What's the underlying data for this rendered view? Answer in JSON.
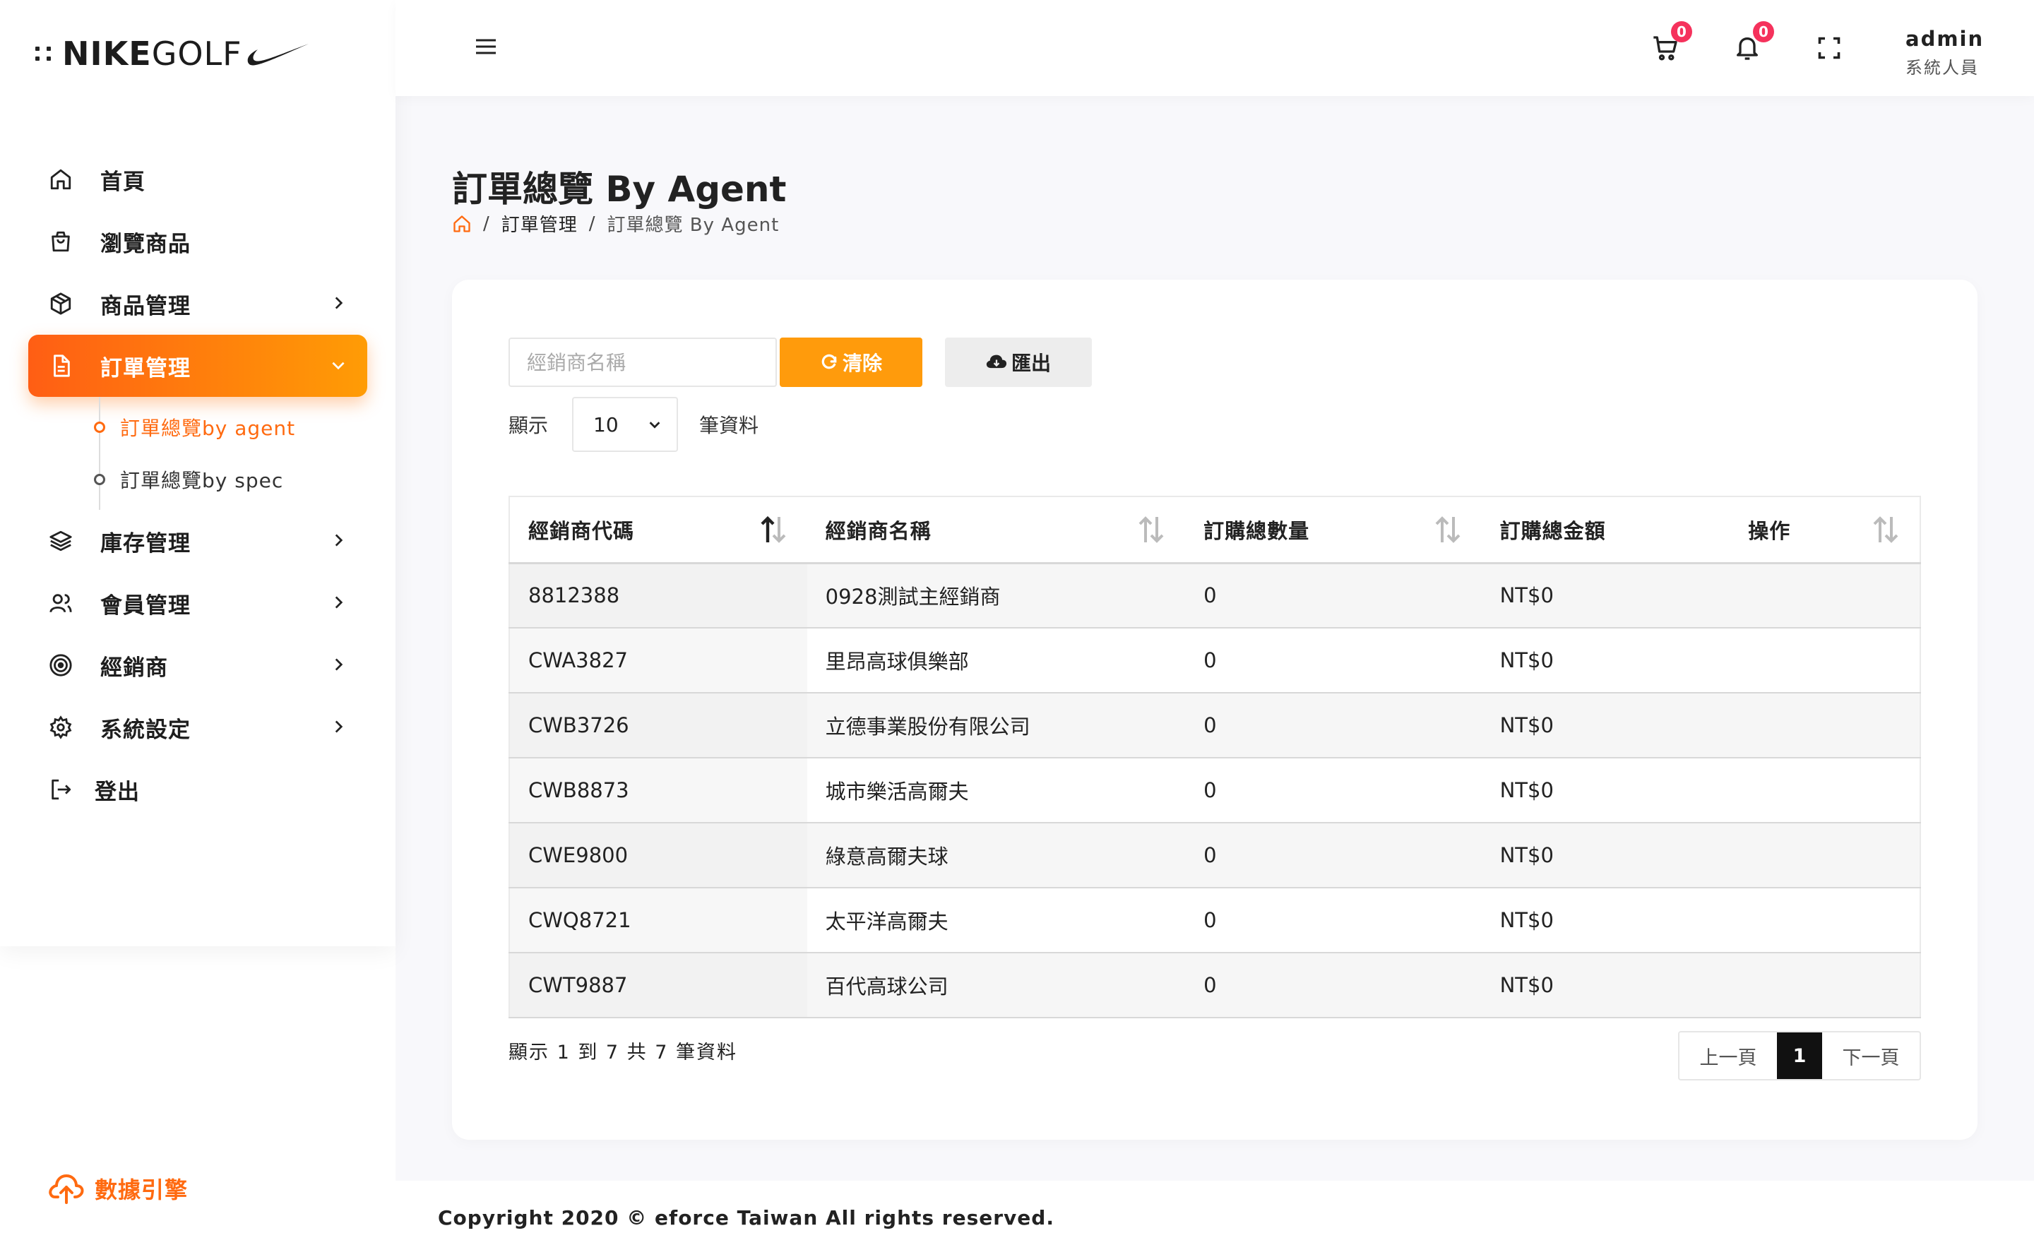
{
  "brand": {
    "logo_text_bold": "NIKE",
    "logo_text_light": "GOLF"
  },
  "sidebar": {
    "items": [
      {
        "label": "首頁",
        "icon": "home-icon"
      },
      {
        "label": "瀏覽商品",
        "icon": "shopping-bag-icon"
      },
      {
        "label": "商品管理",
        "icon": "box-icon"
      },
      {
        "label": "訂單管理",
        "icon": "file-text-icon"
      },
      {
        "label": "庫存管理",
        "icon": "layers-icon"
      },
      {
        "label": "會員管理",
        "icon": "users-icon"
      },
      {
        "label": "經銷商",
        "icon": "target-icon"
      },
      {
        "label": "系統設定",
        "icon": "gear-icon"
      },
      {
        "label": "登出",
        "icon": "logout-icon"
      }
    ],
    "subitems": [
      {
        "label": "訂單總覽by agent"
      },
      {
        "label": "訂單總覽by spec"
      }
    ],
    "data_engine": "數據引擎"
  },
  "header": {
    "cart_count": "0",
    "notification_count": "0",
    "user_name": "admin",
    "user_role": "系統人員"
  },
  "page": {
    "title": "訂單總覽 By Agent",
    "breadcrumb": {
      "section": "訂單管理",
      "current": "訂單總覽 By Agent"
    }
  },
  "filters": {
    "search_placeholder": "經銷商名稱",
    "clear_label": "清除",
    "export_label": "匯出",
    "show_label": "顯示",
    "page_length": "10",
    "records_label": "筆資料"
  },
  "table": {
    "columns": [
      "經銷商代碼",
      "經銷商名稱",
      "訂購總數量",
      "訂購總金額",
      "操作"
    ],
    "rows": [
      [
        "8812388",
        "0928測試主經銷商",
        "0",
        "NT$0",
        ""
      ],
      [
        "CWA3827",
        "里昂高球俱樂部",
        "0",
        "NT$0",
        ""
      ],
      [
        "CWB3726",
        "立德事業股份有限公司",
        "0",
        "NT$0",
        ""
      ],
      [
        "CWB8873",
        "城市樂活高爾夫",
        "0",
        "NT$0",
        ""
      ],
      [
        "CWE9800",
        "綠意高爾夫球",
        "0",
        "NT$0",
        ""
      ],
      [
        "CWQ8721",
        "太平洋高爾夫",
        "0",
        "NT$0",
        ""
      ],
      [
        "CWT9887",
        "百代高球公司",
        "0",
        "NT$0",
        ""
      ]
    ]
  },
  "pagination": {
    "info": "顯示 1 到 7 共 7 筆資料",
    "prev": "上一頁",
    "current": "1",
    "next": "下一頁"
  },
  "footer": {
    "copyright": "Copyright 2020 © eforce Taiwan All rights reserved."
  },
  "colors": {
    "accent": "#ff6a10",
    "accent_gradient_end": "#ff9c05",
    "badge": "#f5325c"
  }
}
